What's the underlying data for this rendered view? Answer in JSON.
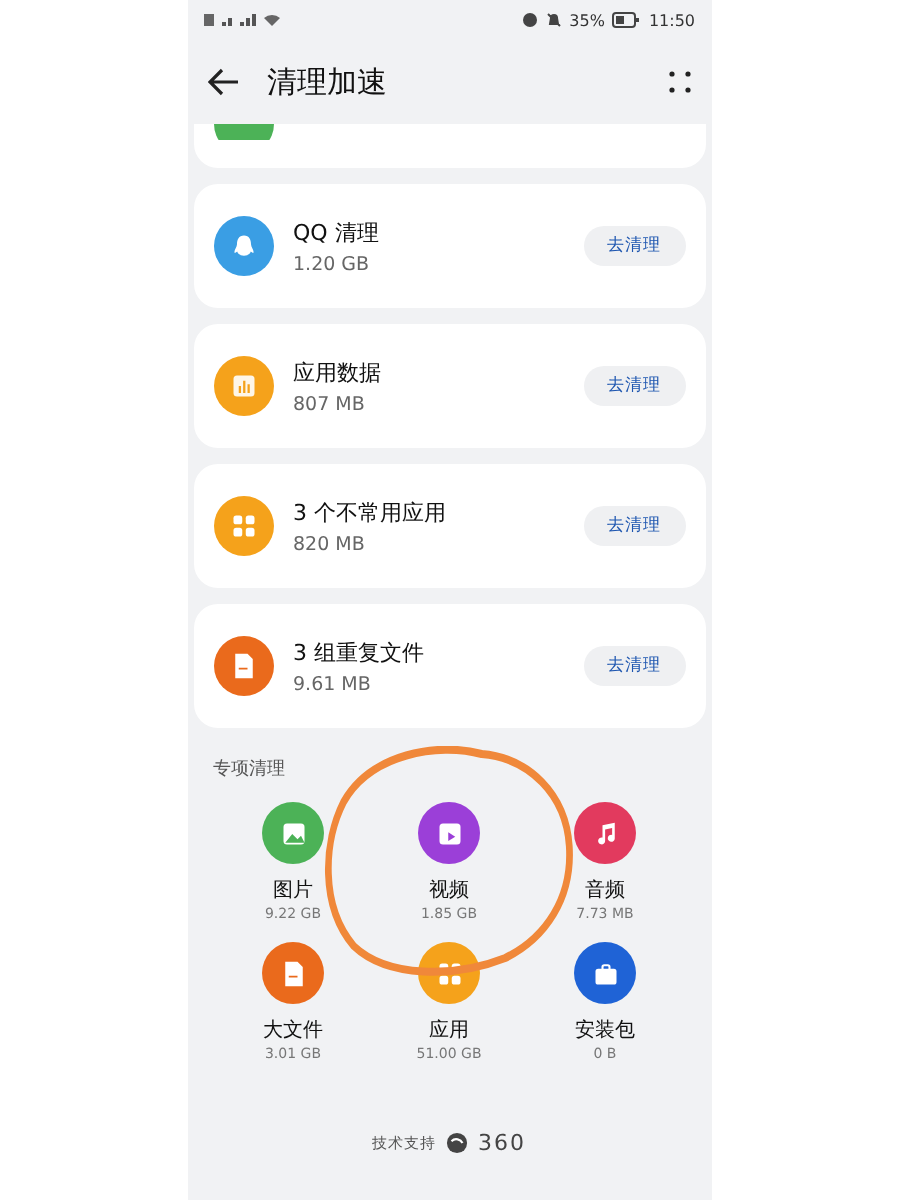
{
  "status_bar": {
    "battery": "35%",
    "time": "11:50"
  },
  "header": {
    "title": "清理加速"
  },
  "items": [
    {
      "kind": "qq",
      "color": "#3a9ee4",
      "name": "QQ 清理",
      "size": "1.20 GB",
      "action": "去清理"
    },
    {
      "kind": "chart",
      "color": "#f5a21b",
      "name": "应用数据",
      "size": "807 MB",
      "action": "去清理"
    },
    {
      "kind": "apps",
      "color": "#f5a21b",
      "name": "3 个不常用应用",
      "size": "820 MB",
      "action": "去清理"
    },
    {
      "kind": "file",
      "color": "#ea6a1c",
      "name": "3 组重复文件",
      "size": "9.61 MB",
      "action": "去清理"
    }
  ],
  "special": {
    "title": "专项清理",
    "tiles": [
      {
        "kind": "image",
        "color": "#4cb257",
        "name": "图片",
        "size": "9.22 GB"
      },
      {
        "kind": "video",
        "color": "#9b3fd8",
        "name": "视频",
        "size": "1.85 GB"
      },
      {
        "kind": "music",
        "color": "#e23a5e",
        "name": "音频",
        "size": "7.73 MB"
      },
      {
        "kind": "file",
        "color": "#ea6a1c",
        "name": "大文件",
        "size": "3.01 GB"
      },
      {
        "kind": "apps",
        "color": "#f5a21b",
        "name": "应用",
        "size": "51.00 GB"
      },
      {
        "kind": "package",
        "color": "#1f63d6",
        "name": "安装包",
        "size": "0 B"
      }
    ]
  },
  "footer": {
    "label": "技术支持",
    "brand": "360"
  }
}
